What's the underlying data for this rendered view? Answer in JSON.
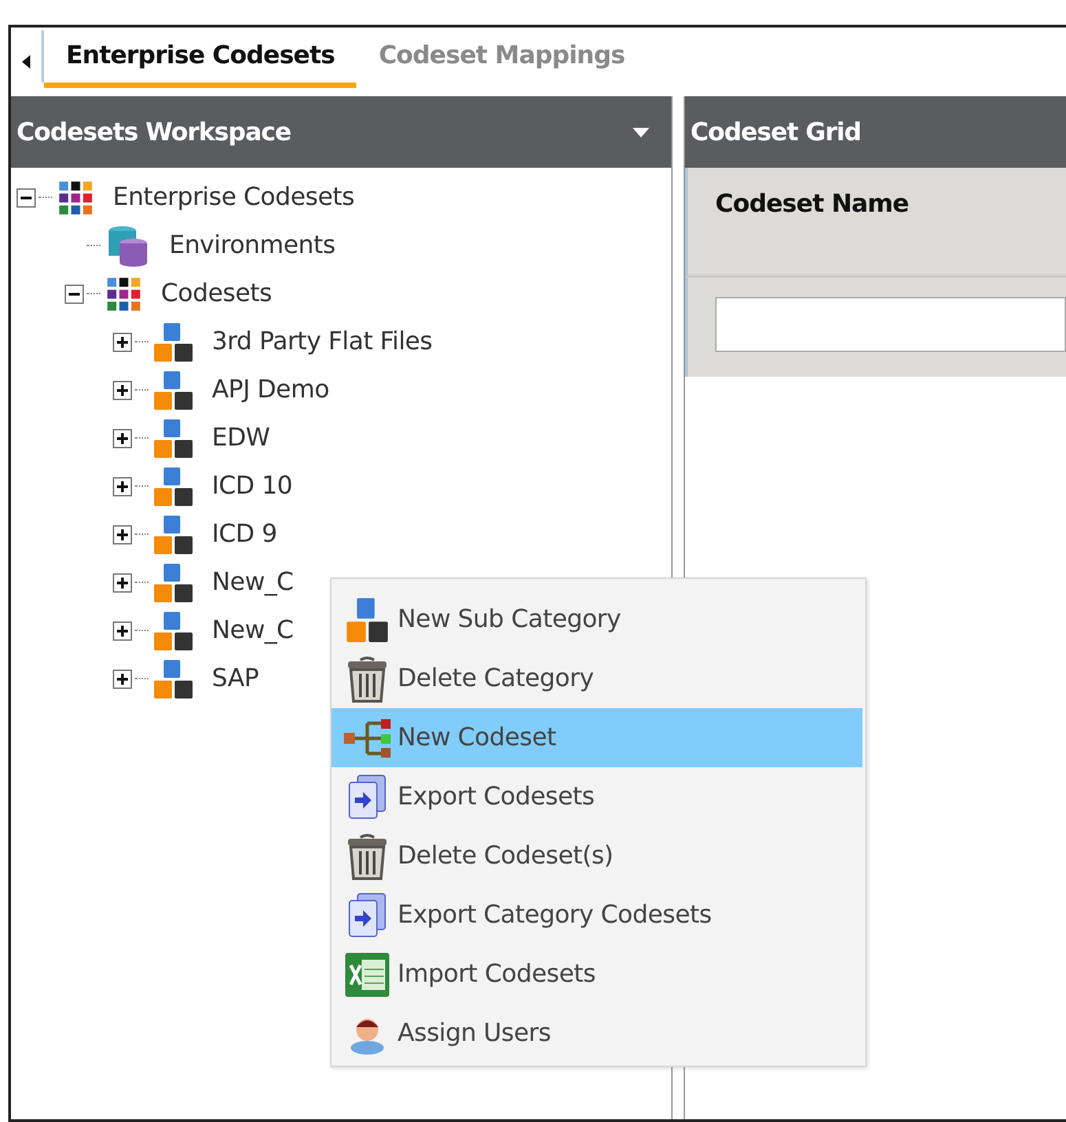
{
  "tabs": [
    {
      "label": "Enterprise Codesets",
      "selected": true
    },
    {
      "label": "Codeset Mappings",
      "selected": false
    }
  ],
  "workspace": {
    "title": "Codesets Workspace",
    "tree": [
      {
        "label": "Enterprise Codesets",
        "kind": "grid",
        "expanded": true,
        "children": [
          {
            "label": "Environments",
            "kind": "database"
          },
          {
            "label": "Codesets",
            "kind": "grid",
            "expanded": true,
            "children": [
              {
                "label": "3rd Party Flat Files",
                "kind": "category",
                "expanded": false
              },
              {
                "label": "APJ Demo",
                "kind": "category",
                "expanded": false
              },
              {
                "label": "EDW",
                "kind": "category",
                "expanded": false
              },
              {
                "label": "ICD 10",
                "kind": "category",
                "expanded": false
              },
              {
                "label": "ICD 9",
                "kind": "category",
                "expanded": false
              },
              {
                "label": "New_C",
                "kind": "category",
                "expanded": false
              },
              {
                "label": "New_C",
                "kind": "category",
                "expanded": false
              },
              {
                "label": "SAP",
                "kind": "category",
                "expanded": false
              }
            ]
          }
        ]
      }
    ]
  },
  "grid": {
    "title": "Codeset Grid",
    "columns": [
      {
        "label": "Codeset Name"
      }
    ]
  },
  "context_menu": [
    {
      "label": "New Sub Category",
      "kind": "category",
      "selected": false
    },
    {
      "label": "Delete Category",
      "kind": "delete",
      "selected": false
    },
    {
      "label": "New Codeset",
      "kind": "tree",
      "selected": true
    },
    {
      "label": "Export Codesets",
      "kind": "export",
      "selected": false
    },
    {
      "label": "Delete Codeset(s)",
      "kind": "delete",
      "selected": false
    },
    {
      "label": "Export Category Codesets",
      "kind": "export",
      "selected": false
    },
    {
      "label": "Import Codesets",
      "kind": "excel",
      "selected": false
    },
    {
      "label": "Assign Users",
      "kind": "user",
      "selected": false
    }
  ]
}
